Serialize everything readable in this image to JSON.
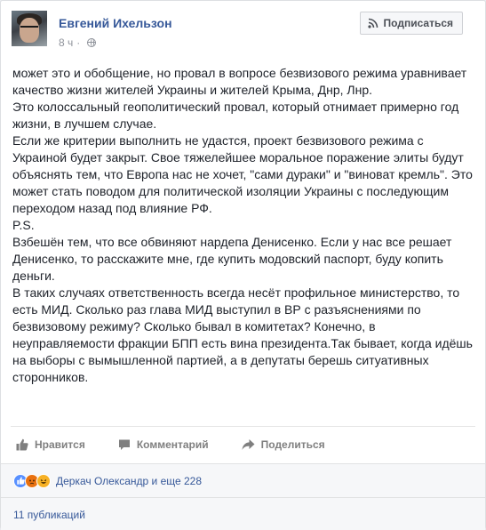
{
  "post": {
    "author": "Евгений Ихельзон",
    "time": "8 ч",
    "time_separator": "·",
    "follow_label": "Подписаться",
    "paragraphs": [
      "может это и обобщение, но провал в вопросе безвизового режима уравнивает качество жизни жителей Украины и жителей Крыма, Днр, Лнр.",
      "Это колоссальный геополитический провал, который отнимает примерно год жизни, в лучшем случае.",
      "Если же критерии выполнить не удастся, проект безвизового режима с Украиной будет закрыт. Свое тяжелейшее моральное поражение элиты будут объяснять тем, что Европа нас не хочет, \"сами дураки\" и \"виноват кремль\". Это может стать поводом для политической изоляции Украины с последующим переходом назад под влияние РФ.",
      "P.S.",
      "Взбешён тем, что все обвиняют нардепа Денисенко. Если у нас все решает Денисенко, то расскажите мне, где купить модовский паспорт, буду копить деньги.",
      "В таких случаях ответственность всегда несёт профильное министерство, то есть МИД. Сколько раз глава МИД выступил в ВР с разъяснениями по безвизовому режиму? Сколько бывал в комитетах? Конечно, в неуправляемости фракции БПП есть вина президента.Так бывает, когда идёшь на выборы с вымышленной партией, а в депутаты берешь ситуативных сторонников."
    ]
  },
  "actions": {
    "like": "Нравится",
    "comment": "Комментарий",
    "share": "Поделиться"
  },
  "reactions": {
    "summary": "Деркач Олександр и еще 228",
    "icons": [
      "like-reaction-icon",
      "angry-reaction-icon",
      "haha-reaction-icon"
    ]
  },
  "shares": {
    "label": "11 публикаций"
  },
  "colors": {
    "link": "#365899",
    "muted": "#90949c",
    "text": "#1d2129",
    "like_reaction": "#5890ff",
    "angry_reaction": "#e9710f",
    "haha_reaction": "#f7b125"
  }
}
